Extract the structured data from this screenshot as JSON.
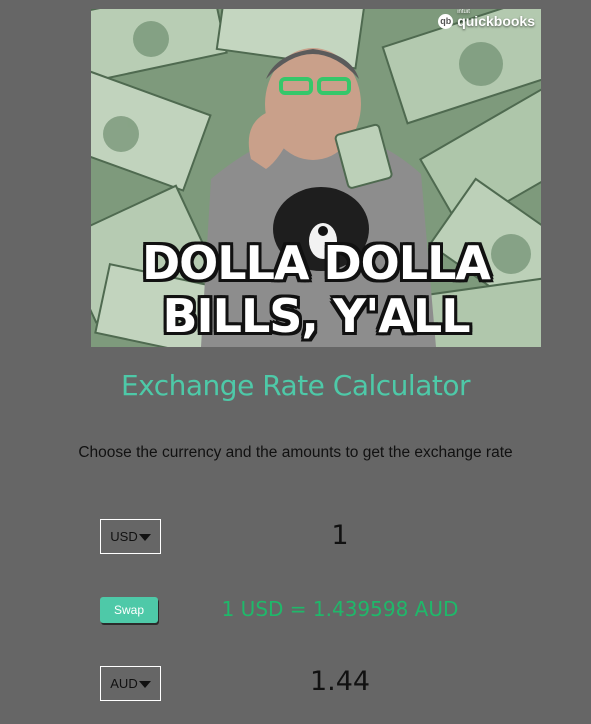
{
  "hero": {
    "brand_small": "intuit",
    "brand_name": "quickbooks",
    "caption_line_1": "DOLLA DOLLA",
    "caption_line_2": "BILLS, Y'ALL"
  },
  "title": "Exchange Rate Calculator",
  "subtitle": "Choose the currency and the amounts to get the exchange rate",
  "currency_one": {
    "code": "USD",
    "amount": "1"
  },
  "swap": {
    "label": "Swap"
  },
  "rate_text": "1 USD = 1.439598 AUD",
  "currency_two": {
    "code": "AUD",
    "amount": "1.44"
  },
  "colors": {
    "background": "#666666",
    "accent": "#4ec9a8",
    "rate_text": "#1fb86a",
    "text": "#111111"
  }
}
